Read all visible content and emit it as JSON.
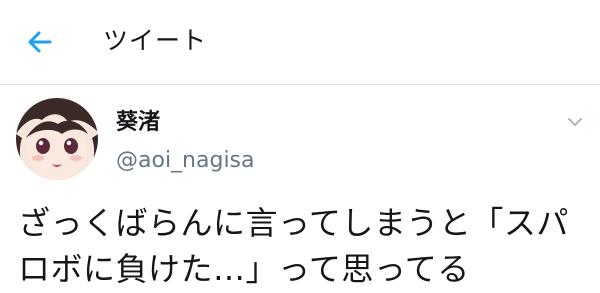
{
  "header": {
    "title": "ツイート",
    "back_icon": "arrow-left-icon"
  },
  "tweet": {
    "display_name": "葵渚",
    "handle": "@aoi_nagisa",
    "avatar": "avatar-anime-character",
    "caret_icon": "chevron-down-icon",
    "text": "ざっくばらんに言ってしまうと「スパロボに負けた…」って思ってる"
  },
  "colors": {
    "accent": "#1da1f2",
    "text_primary": "#14171a",
    "text_secondary": "#657786",
    "divider": "#d9dde1"
  }
}
